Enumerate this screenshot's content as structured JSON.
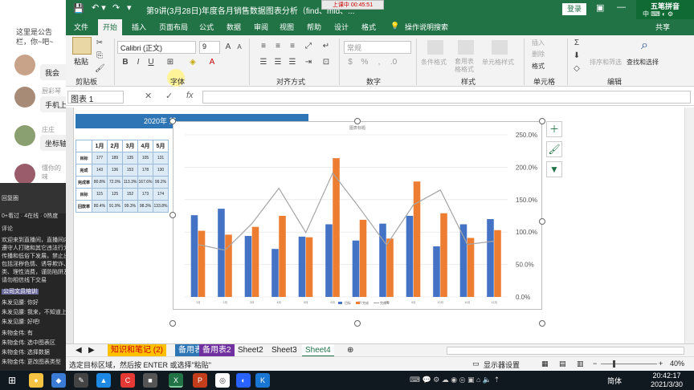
{
  "chat": {
    "notice": "这里是公告栏，你~吧~",
    "messages": [
      {
        "user": "",
        "text": "我会"
      },
      {
        "user": "厨彩琴",
        "text": "手机上"
      },
      {
        "user": "庄庄",
        "text": "坐标轴"
      },
      {
        "user": "懂你的味",
        "text": ""
      }
    ],
    "dark_lines": [
      "回复圈",
      "0+看过 · 4在线 · 0热度",
      "评论",
      "欢迎来到直播间，直播间内禁止",
      "遵守人打赌和其它违法行为，禁止",
      "传播和低俗下发展，禁止出现违规",
      "包括淫秽色情、诱导欺诈、抽烟喝酒",
      "类、理性消费，谨防陷阱及人身安全",
      "请勿相信线下交易",
      "公司文员培训",
      "朱发见腰: 你好",
      "朱发见腰: 我来，不知道上次讲什么",
      "朱发见腰: 好吧!",
      "朱物金伟: 有",
      "朱物金伟: 选中图表区",
      "朱物金伟: 选择数据",
      "朱物金伟: 更改图表类型"
    ]
  },
  "titlebar": {
    "title": "第9讲(3月28日)年度各月销售数据图表分析（find、mid、...",
    "live": "上课中 00:45:51",
    "login": "登录",
    "ime": "五笔拼音"
  },
  "menu": [
    "文件",
    "开始",
    "插入",
    "页面布局",
    "公式",
    "数据",
    "审阅",
    "视图",
    "帮助",
    "设计",
    "格式",
    "操作说明搜索",
    "共享"
  ],
  "ribbon": {
    "paste": "粘贴",
    "clipboard": "剪贴板",
    "font_name": "Calibri (正文)",
    "font_size": "9",
    "font_group": "字体",
    "align_group": "对齐方式",
    "number_format": "常规",
    "number_group": "数字",
    "cond_format": "条件格式",
    "table_format": "套用表格格式",
    "cell_style": "单元格样式",
    "style_group": "样式",
    "insert": "插入",
    "delete": "删除",
    "format": "格式",
    "cells_group": "单元格",
    "sort": "排序和筛选",
    "find": "查找和选择",
    "edit_group": "编辑"
  },
  "namebox": "图表 1",
  "sheet": {
    "banner": "2020年 某",
    "months": [
      "1月",
      "2月",
      "3月",
      "4月",
      "5月"
    ],
    "rows": [
      {
        "label": "目标",
        "values": [
          "177",
          "189",
          "135",
          "105",
          "131"
        ]
      },
      {
        "label": "完成",
        "values": [
          "143",
          "136",
          "153",
          "178",
          "130"
        ]
      },
      {
        "label": "完成率",
        "values": [
          "80.8%",
          "72.0%",
          "113.3%",
          "167.6%",
          "99.2%"
        ]
      },
      {
        "label": "目标",
        "values": [
          "115",
          "125",
          "152",
          "173",
          "174"
        ]
      },
      {
        "label": "回款率",
        "values": [
          "80.4%",
          "91.9%",
          "99.3%",
          "98.3%",
          "133.8%"
        ]
      }
    ]
  },
  "chart_data": {
    "type": "bar",
    "title": "图表标题",
    "categories": [
      "1月",
      "2月",
      "3月",
      "4月",
      "5月",
      "6月",
      "7月",
      "8月",
      "9月",
      "10月",
      "11月",
      "12月"
    ],
    "series": [
      {
        "name": "目标",
        "kind": "bar",
        "color": "#4472c4",
        "values": [
          126,
          136,
          94,
          74,
          93,
          112,
          87,
          113,
          125,
          78,
          112,
          120
        ]
      },
      {
        "name": "完成",
        "kind": "bar",
        "color": "#ed7d31",
        "values": [
          102,
          96,
          108,
          125,
          92,
          214,
          119,
          90,
          178,
          129,
          91,
          103
        ]
      },
      {
        "name": "完成率",
        "kind": "line",
        "color": "#a5a5a5",
        "values": [
          80.8,
          72.0,
          113.3,
          167.6,
          99.2,
          191,
          137,
          80,
          142,
          165,
          81,
          86
        ]
      }
    ],
    "ylim": [
      0,
      250
    ],
    "y2_ticks": [
      "0.0%",
      "50.0%",
      "100.0%",
      "150.0%",
      "200.0%",
      "250.0%"
    ],
    "legend": "bottom"
  },
  "tabs": [
    "知识和笔记 (2)",
    "备用表1",
    "备用表2",
    "Sheet2",
    "Sheet3",
    "Sheet4"
  ],
  "status": {
    "text": "选定目标区域，然后按 ENTER 或选择\"粘贴\"",
    "display": "显示器设置",
    "zoom": "40%"
  },
  "taskbar": {
    "time": "20:42:17",
    "date": "2021/3/30",
    "lang": "简体"
  }
}
